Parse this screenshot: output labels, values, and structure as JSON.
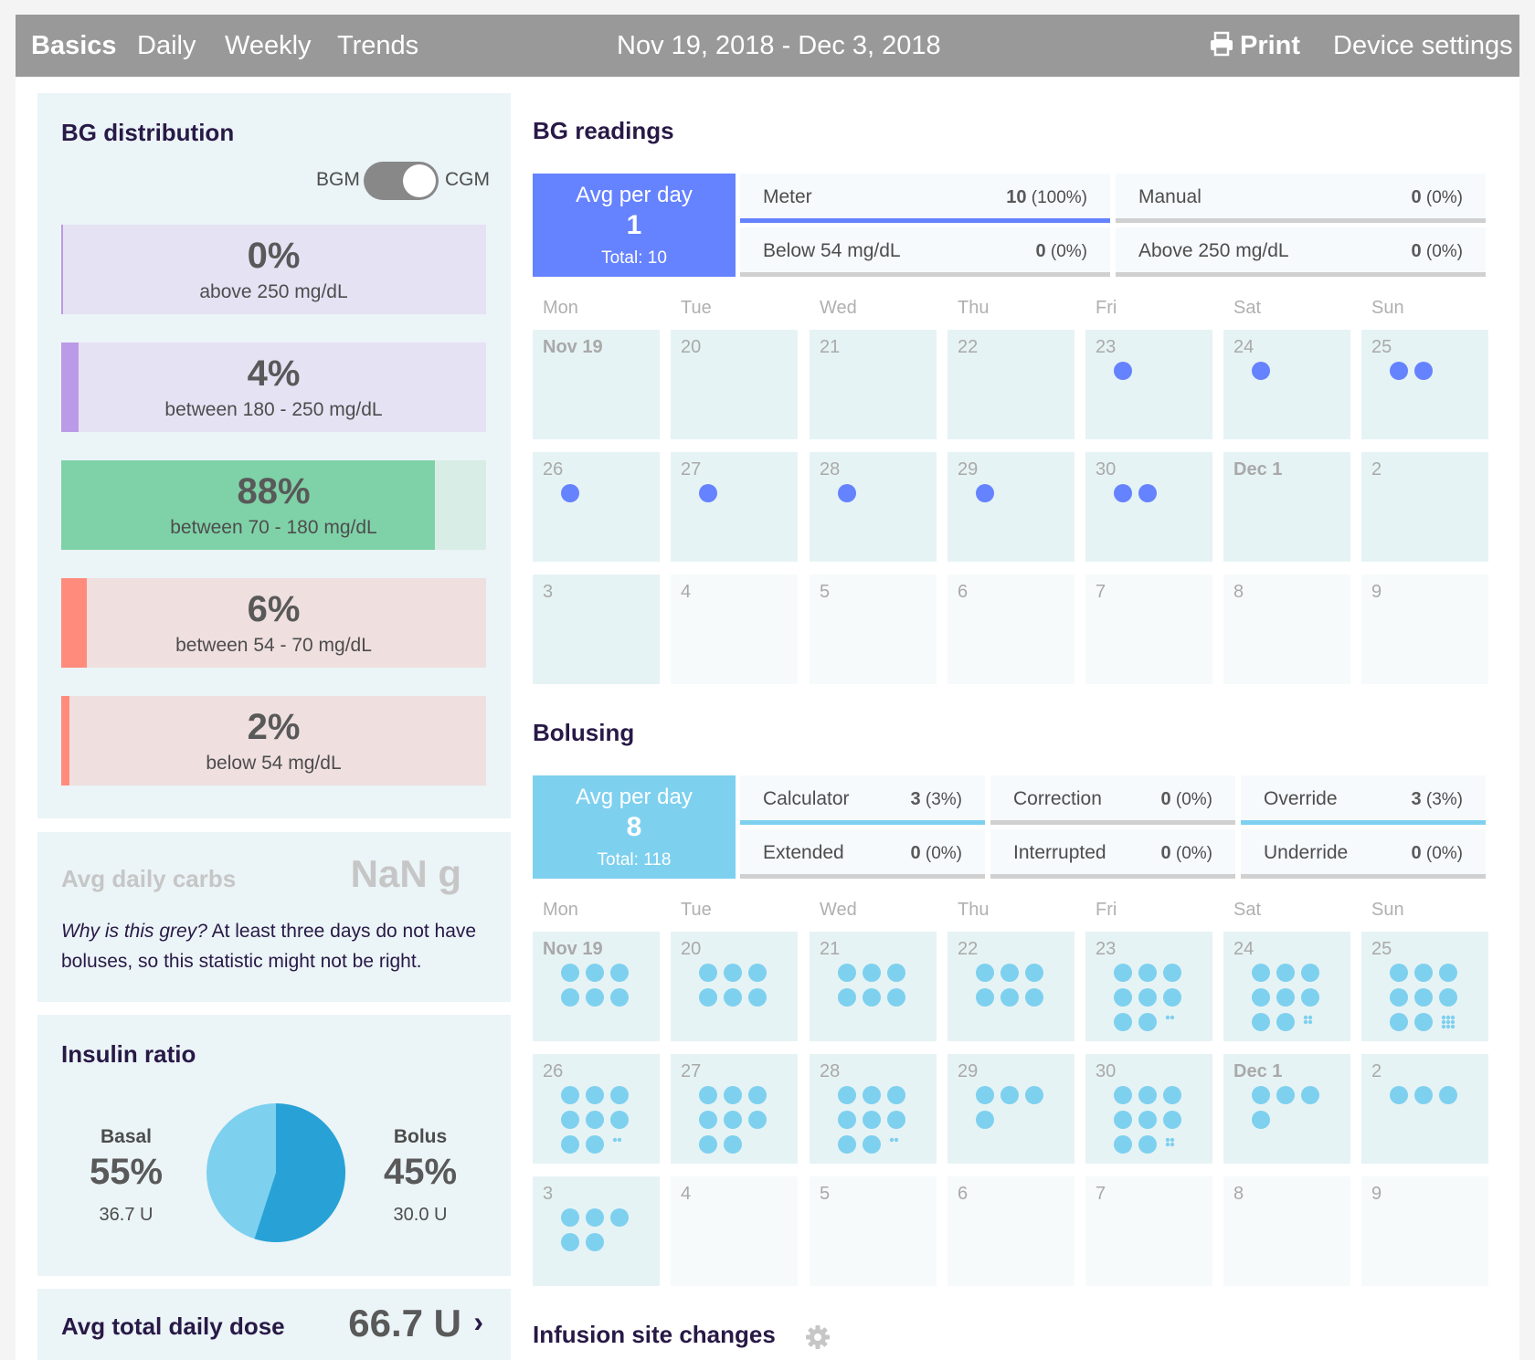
{
  "header": {
    "tabs": [
      "Basics",
      "Daily",
      "Weekly",
      "Trends"
    ],
    "date_range": "Nov 19, 2018 - Dec 3, 2018",
    "print_label": "Print",
    "device_settings_label": "Device settings"
  },
  "bg_distribution": {
    "title": "BG distribution",
    "toggle": {
      "left": "BGM",
      "right": "CGM",
      "selected": "CGM"
    },
    "ranges": [
      {
        "pct": "0%",
        "label": "above 250 mg/dL",
        "value": 0,
        "color": "#bb9ae7",
        "bg": "#e5e2f4"
      },
      {
        "pct": "4%",
        "label": "between 180 - 250 mg/dL",
        "value": 4,
        "color": "#bb9ae7",
        "bg": "#e5e2f4"
      },
      {
        "pct": "88%",
        "label": "between 70 - 180 mg/dL",
        "value": 88,
        "color": "#7fd2a8",
        "bg": "#d9ede7"
      },
      {
        "pct": "6%",
        "label": "between 54 - 70 mg/dL",
        "value": 6,
        "color": "#ff8b7c",
        "bg": "#efdfdf"
      },
      {
        "pct": "2%",
        "label": "below 54 mg/dL",
        "value": 2,
        "color": "#ff8b7c",
        "bg": "#efdfdf"
      }
    ]
  },
  "carbs": {
    "label": "Avg daily carbs",
    "value": "NaN g",
    "note_italic": "Why is this grey?",
    "note_text": " At least three days do not have boluses, so this statistic might not be right."
  },
  "insulin_ratio": {
    "title": "Insulin ratio",
    "basal": {
      "label": "Basal",
      "pct": "55%",
      "units": "36.7 U",
      "value": 55,
      "color": "#28a2d6"
    },
    "bolus": {
      "label": "Bolus",
      "pct": "45%",
      "units": "30.0 U",
      "value": 45,
      "color": "#7ed0ef"
    }
  },
  "total_dose": {
    "label": "Avg total daily dose",
    "value": "66.7 U",
    "chevron": "›"
  },
  "bg_readings": {
    "title": "BG readings",
    "avg": {
      "label": "Avg per day",
      "value": "1",
      "total_label": "Total:",
      "total": "10",
      "color": "#6582ff"
    },
    "stats": [
      {
        "label": "Meter",
        "count": "10",
        "pct": "(100%)",
        "bar": "#6582ff"
      },
      {
        "label": "Manual",
        "count": "0",
        "pct": "(0%)",
        "bar": "#d0d0d0"
      },
      {
        "label": "Below 54 mg/dL",
        "count": "0",
        "pct": "(0%)",
        "bar": "#d0d0d0"
      },
      {
        "label": "Above 250 mg/dL",
        "count": "0",
        "pct": "(0%)",
        "bar": "#d0d0d0"
      }
    ],
    "weekdays": [
      "Mon",
      "Tue",
      "Wed",
      "Thu",
      "Fri",
      "Sat",
      "Sun"
    ],
    "days": [
      {
        "d": "Nov 19",
        "n": 0
      },
      {
        "d": "20",
        "n": 0
      },
      {
        "d": "21",
        "n": 0
      },
      {
        "d": "22",
        "n": 0
      },
      {
        "d": "23",
        "n": 1
      },
      {
        "d": "24",
        "n": 1
      },
      {
        "d": "25",
        "n": 2
      },
      {
        "d": "26",
        "n": 1
      },
      {
        "d": "27",
        "n": 1
      },
      {
        "d": "28",
        "n": 1
      },
      {
        "d": "29",
        "n": 1
      },
      {
        "d": "30",
        "n": 2
      },
      {
        "d": "Dec 1",
        "n": 0
      },
      {
        "d": "2",
        "n": 0
      },
      {
        "d": "3",
        "n": 0
      },
      {
        "d": "4",
        "n": 0
      },
      {
        "d": "5",
        "n": 0
      },
      {
        "d": "6",
        "n": 0
      },
      {
        "d": "7",
        "n": 0
      },
      {
        "d": "8",
        "n": 0
      },
      {
        "d": "9",
        "n": 0
      }
    ]
  },
  "bolusing": {
    "title": "Bolusing",
    "avg": {
      "label": "Avg per day",
      "value": "8",
      "total_label": "Total:",
      "total": "118",
      "color": "#7ed0ef"
    },
    "stats": [
      {
        "label": "Calculator",
        "count": "3",
        "pct": "(3%)",
        "bar": "#7ed0ef"
      },
      {
        "label": "Correction",
        "count": "0",
        "pct": "(0%)",
        "bar": "#d0d0d0"
      },
      {
        "label": "Override",
        "count": "3",
        "pct": "(3%)",
        "bar": "#7ed0ef"
      },
      {
        "label": "Extended",
        "count": "0",
        "pct": "(0%)",
        "bar": "#d0d0d0"
      },
      {
        "label": "Interrupted",
        "count": "0",
        "pct": "(0%)",
        "bar": "#d0d0d0"
      },
      {
        "label": "Underride",
        "count": "0",
        "pct": "(0%)",
        "bar": "#d0d0d0"
      }
    ],
    "weekdays": [
      "Mon",
      "Tue",
      "Wed",
      "Thu",
      "Fri",
      "Sat",
      "Sun"
    ],
    "days": [
      {
        "d": "Nov 19",
        "n": 6
      },
      {
        "d": "20",
        "n": 6
      },
      {
        "d": "21",
        "n": 6
      },
      {
        "d": "22",
        "n": 6
      },
      {
        "d": "23",
        "n": 10
      },
      {
        "d": "24",
        "n": 12
      },
      {
        "d": "25",
        "n": 17
      },
      {
        "d": "26",
        "n": 10
      },
      {
        "d": "27",
        "n": 8
      },
      {
        "d": "28",
        "n": 10
      },
      {
        "d": "29",
        "n": 4
      },
      {
        "d": "30",
        "n": 12
      },
      {
        "d": "Dec 1",
        "n": 4
      },
      {
        "d": "2",
        "n": 3
      },
      {
        "d": "3",
        "n": 5
      },
      {
        "d": "4",
        "n": 0
      },
      {
        "d": "5",
        "n": 0
      },
      {
        "d": "6",
        "n": 0
      },
      {
        "d": "7",
        "n": 0
      },
      {
        "d": "8",
        "n": 0
      },
      {
        "d": "9",
        "n": 0
      }
    ]
  },
  "infusion": {
    "title": "Infusion site changes"
  },
  "icons": {
    "print": "printer-icon",
    "settings": "gear-icon"
  }
}
